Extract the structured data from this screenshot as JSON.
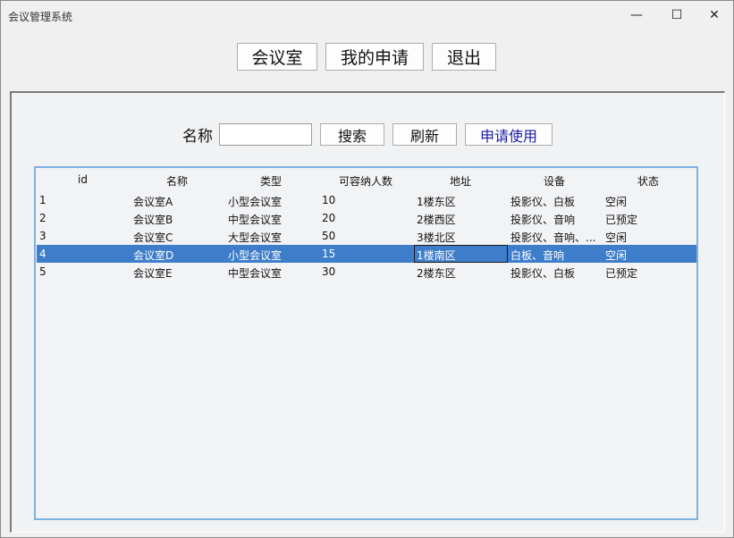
{
  "window": {
    "title": "会议管理系统",
    "minimize_glyph": "—",
    "maximize_glyph": "☐",
    "close_glyph": "✕"
  },
  "nav": {
    "meeting_rooms": "会议室",
    "my_applications": "我的申请",
    "exit": "退出"
  },
  "search": {
    "label": "名称",
    "value": "",
    "search_button": "搜索",
    "refresh_button": "刷新",
    "apply_button": "申请使用"
  },
  "table": {
    "columns": [
      "id",
      "名称",
      "类型",
      "可容纳人数",
      "地址",
      "设备",
      "状态"
    ],
    "rows": [
      [
        "1",
        "会议室A",
        "小型会议室",
        "10",
        "1楼东区",
        "投影仪、白板",
        "空闲"
      ],
      [
        "2",
        "会议室B",
        "中型会议室",
        "20",
        "2楼西区",
        "投影仪、音响",
        "已预定"
      ],
      [
        "3",
        "会议室C",
        "大型会议室",
        "50",
        "3楼北区",
        "投影仪、音响、...",
        "空闲"
      ],
      [
        "4",
        "会议室D",
        "小型会议室",
        "15",
        "1楼南区",
        "白板、音响",
        "空闲"
      ],
      [
        "5",
        "会议室E",
        "中型会议室",
        "30",
        "2楼东区",
        "投影仪、白板",
        "已预定"
      ]
    ],
    "selected_row": 4,
    "selection_color": "#3d7dca",
    "border_color": "#7eb0e0"
  }
}
